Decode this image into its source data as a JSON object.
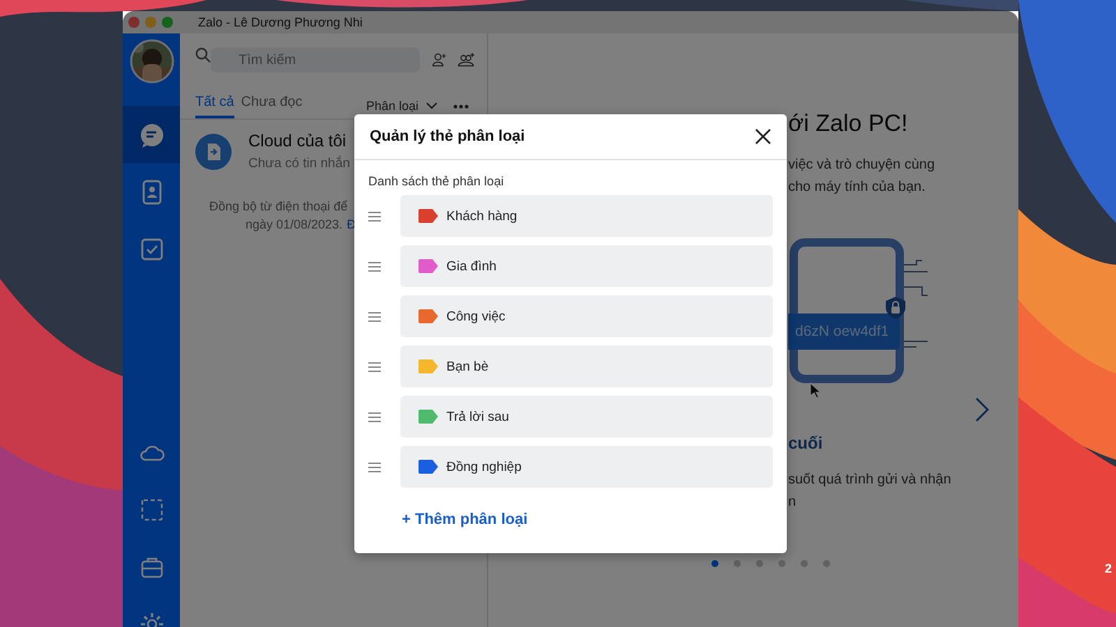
{
  "desktop": {
    "label": "2"
  },
  "window": {
    "title": "Zalo - Lê Dương Phương Nhi"
  },
  "sidebar": {
    "items": [
      {
        "kind": "chat",
        "selected": true
      },
      {
        "kind": "contacts",
        "selected": false
      },
      {
        "kind": "todo",
        "selected": false
      },
      {
        "kind": "cloud",
        "selected": false
      },
      {
        "kind": "capture",
        "selected": false
      },
      {
        "kind": "tools",
        "selected": false
      },
      {
        "kind": "settings",
        "selected": false
      }
    ]
  },
  "chat_list": {
    "search": {
      "placeholder": "Tìm kiếm"
    },
    "tabs": [
      {
        "label": "Tất cả",
        "selected": true
      },
      {
        "label": "Chưa đọc",
        "selected": false
      }
    ],
    "filter": {
      "label": "Phân loại"
    },
    "conversations": [
      {
        "title": "Cloud của tôi",
        "preview": "Chưa có tin nhắn"
      }
    ],
    "sync_notice": {
      "line_1": "Đồng bộ từ điện thoại để",
      "line_2": "ngày 01/08/2023.",
      "link": "Đ"
    }
  },
  "welcome": {
    "heading": "ới Zalo PC!",
    "intro_lines": [
      "việc và trò chuyện cùng",
      "cho máy tính của bạn."
    ],
    "key_card": "d6zN oew4df1",
    "feature_title": "cuối",
    "feature_lines": [
      "suốt quá trình gửi và nhận",
      "n"
    ],
    "dots": [
      {
        "selected": true
      },
      {
        "selected": false
      },
      {
        "selected": false
      },
      {
        "selected": false
      },
      {
        "selected": false
      },
      {
        "selected": false
      }
    ]
  },
  "dialog": {
    "title": "Quản lý thẻ phân loại",
    "list_label": "Danh sách thẻ phân loại",
    "tags": [
      {
        "label": "Khách hàng",
        "color": "#d9412f"
      },
      {
        "label": "Gia đình",
        "color": "#e05cc8"
      },
      {
        "label": "Công việc",
        "color": "#e8692e"
      },
      {
        "label": "Bạn bè",
        "color": "#f4b72c"
      },
      {
        "label": "Trả lời sau",
        "color": "#4dbb6b"
      },
      {
        "label": "Đồng nghiệp",
        "color": "#1a5fe0"
      }
    ],
    "add_button": "+ Thêm phân loại"
  }
}
